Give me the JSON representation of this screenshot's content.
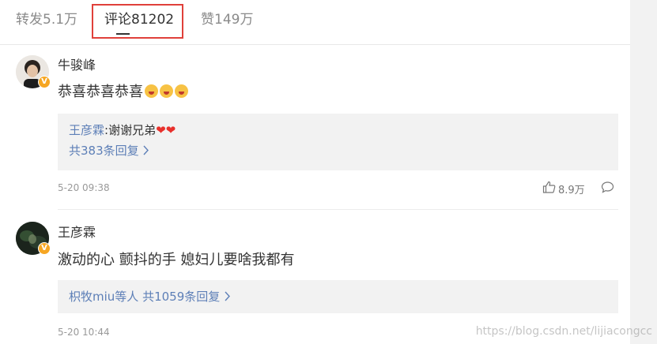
{
  "tabs": [
    {
      "label": "转发5.1万"
    },
    {
      "label": "评论81202"
    },
    {
      "label": "赞149万"
    }
  ],
  "comments": [
    {
      "username": "牛骏峰",
      "text": "恭喜恭喜恭喜",
      "reply_author": "王彦霖",
      "reply_text": ":谢谢兄弟",
      "reply_count": "共383条回复",
      "time": "5-20 09:38",
      "likes": "8.9万"
    },
    {
      "username": "王彦霖",
      "text": "激动的心 颤抖的手 媳妇儿要啥我都有",
      "reply_author": "枳牧miu等人",
      "reply_count": "共1059条回复",
      "time": "5-20 10:44"
    }
  ],
  "watermark": "https://blog.csdn.net/lijiacongcc",
  "colors": {
    "accent_link": "#5d7fb7",
    "highlight_border": "#e0403a",
    "verified_badge": "#f6a623"
  },
  "icons": [
    "verified-badge-icon",
    "emoji-icon",
    "heart-icon",
    "chevron-right-icon",
    "thumbs-up-icon",
    "comment-bubble-icon"
  ]
}
